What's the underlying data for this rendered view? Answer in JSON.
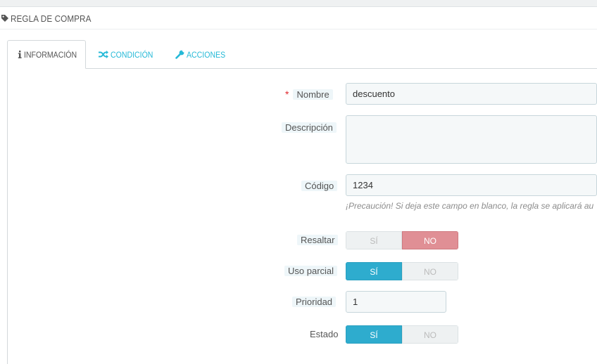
{
  "panel": {
    "title": "REGLA DE COMPRA",
    "icon": "tag-icon"
  },
  "tabs": [
    {
      "label": "INFORMACIÓN",
      "icon": "info-icon",
      "active": true
    },
    {
      "label": "CONDICIÓN",
      "icon": "shuffle-icon",
      "active": false
    },
    {
      "label": "ACCIONES",
      "icon": "wrench-icon",
      "active": false
    }
  ],
  "form": {
    "nombre": {
      "label": "Nombre",
      "required_mark": "*",
      "value": "descuento"
    },
    "descripcion": {
      "label": "Descripción",
      "value": ""
    },
    "codigo": {
      "label": "Código",
      "value": "1234",
      "help": "¡Precaución! Si deja este campo en blanco, la regla se aplicará au"
    },
    "resaltar": {
      "label": "Resaltar",
      "yes": "SÍ",
      "no": "NO",
      "selected": "NO"
    },
    "uso_parcial": {
      "label": "Uso parcial",
      "yes": "SÍ",
      "no": "NO",
      "selected": "SÍ"
    },
    "prioridad": {
      "label": "Prioridad",
      "value": "1"
    },
    "estado": {
      "label": "Estado",
      "yes": "SÍ",
      "no": "NO",
      "selected": "SÍ"
    }
  },
  "colors": {
    "accent": "#25b9d7",
    "switch_on": "#2eacce",
    "switch_no_on": "#e08f95",
    "required": "#e0282e"
  }
}
